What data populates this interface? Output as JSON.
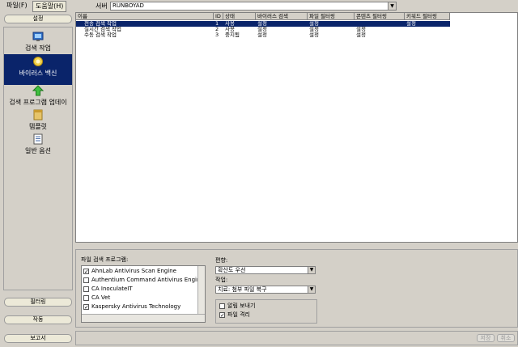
{
  "menubar": {
    "file": "파일(F)",
    "help": "도움말(H)"
  },
  "server": {
    "label": "서버",
    "value": "RUNBOYAD"
  },
  "sections": {
    "settings": "설정",
    "filter": "필터링",
    "action": "작동",
    "report": "보고서"
  },
  "nav": [
    {
      "label": "검색 작업",
      "icon": "scan-task-icon"
    },
    {
      "label": "바이러스 백신",
      "icon": "antivirus-icon"
    },
    {
      "label": "검색 프로그램 업데이",
      "icon": "update-arrow-icon"
    },
    {
      "label": "템플릿",
      "icon": "template-icon"
    },
    {
      "label": "일반 옵션",
      "icon": "document-icon"
    }
  ],
  "table": {
    "columns": [
      "이름",
      "ID",
      "상태",
      "바이러스 검색",
      "파일 필터링",
      "콘텐츠 필터링",
      "키워드 필터링"
    ],
    "rows": [
      {
        "name": "전송 검색 작업",
        "id": "1",
        "status": "사용",
        "virus": "설정",
        "file": "설정",
        "content": "",
        "keyword": "설정"
      },
      {
        "name": "실시간 검색 작업",
        "id": "2",
        "status": "사용",
        "virus": "설정",
        "file": "설정",
        "content": "설정",
        "keyword": ""
      },
      {
        "name": "수동 검색 작업",
        "id": "3",
        "status": "중지됨",
        "virus": "설정",
        "file": "설정",
        "content": "설정",
        "keyword": ""
      }
    ]
  },
  "engines": {
    "label": "파일 검색 프로그램:",
    "items": [
      {
        "name": "AhnLab Antivirus Scan Engine",
        "checked": true
      },
      {
        "name": "Authentium Command Antivirus Engine",
        "checked": false
      },
      {
        "name": "CA InoculateIT",
        "checked": false
      },
      {
        "name": "CA Vet",
        "checked": false
      },
      {
        "name": "Kaspersky Antivirus Technology",
        "checked": true
      }
    ]
  },
  "bias": {
    "label": "편향:",
    "value": "확산도 우선"
  },
  "action": {
    "label": "작업:",
    "value": "치료: 첨부 파일 복구"
  },
  "options": {
    "send_alert": {
      "label": "알림 보내기",
      "checked": false
    },
    "quarantine": {
      "label": "파일 격리",
      "checked": true
    }
  },
  "footer": {
    "save": "저장",
    "cancel": "취소"
  }
}
